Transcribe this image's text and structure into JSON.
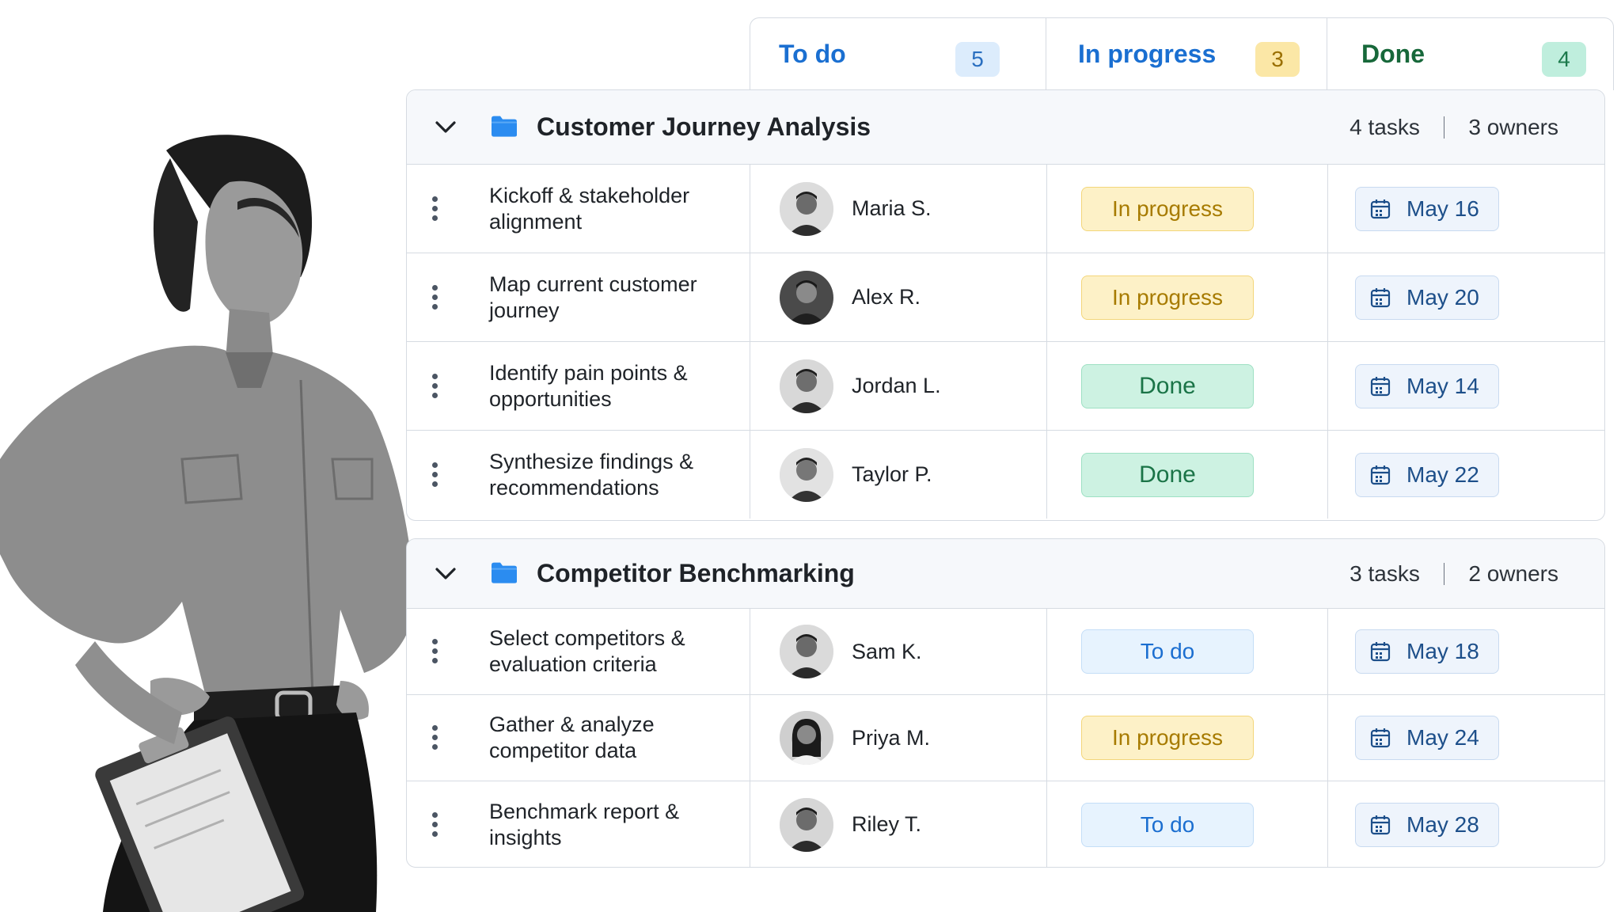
{
  "columns": [
    {
      "label": "To do",
      "count": "5"
    },
    {
      "label": "In progress",
      "count": "3"
    },
    {
      "label": "Done",
      "count": "4"
    }
  ],
  "groups": [
    {
      "title": "Customer Journey Analysis",
      "tasks_count": "4 tasks",
      "owners_count": "3 owners",
      "rows": [
        {
          "task": "Kickoff & stakeholder alignment",
          "owner": "Maria S.",
          "status": "In progress",
          "date": "May 16"
        },
        {
          "task": "Map current customer journey",
          "owner": "Alex R.",
          "status": "In progress",
          "date": "May 20"
        },
        {
          "task": "Identify pain points & opportunities",
          "owner": "Jordan L.",
          "status": "Done",
          "date": "May 14"
        },
        {
          "task": "Synthesize findings & recommendations",
          "owner": "Taylor P.",
          "status": "Done",
          "date": "May 22"
        }
      ]
    },
    {
      "title": "Competitor Benchmarking",
      "tasks_count": "3 tasks",
      "owners_count": "2 owners",
      "rows": [
        {
          "task": "Select competitors & evaluation criteria",
          "owner": "Sam K.",
          "status": "To do",
          "date": "May 18"
        },
        {
          "task": "Gather & analyze competitor data",
          "owner": "Priya M.",
          "status": "In progress",
          "date": "May 24"
        },
        {
          "task": "Benchmark report & insights",
          "owner": "Riley T.",
          "status": "To do",
          "date": "May 28"
        }
      ]
    }
  ],
  "colors": {
    "todo": "#1b6ed0",
    "in_progress": "#a77b00",
    "done": "#1a7447",
    "folder": "#2b8cf0"
  },
  "icons": {
    "collapse": "chevron-down-icon",
    "group": "folder-icon",
    "row_menu": "kebab-menu-icon",
    "due_date": "calendar-icon"
  }
}
